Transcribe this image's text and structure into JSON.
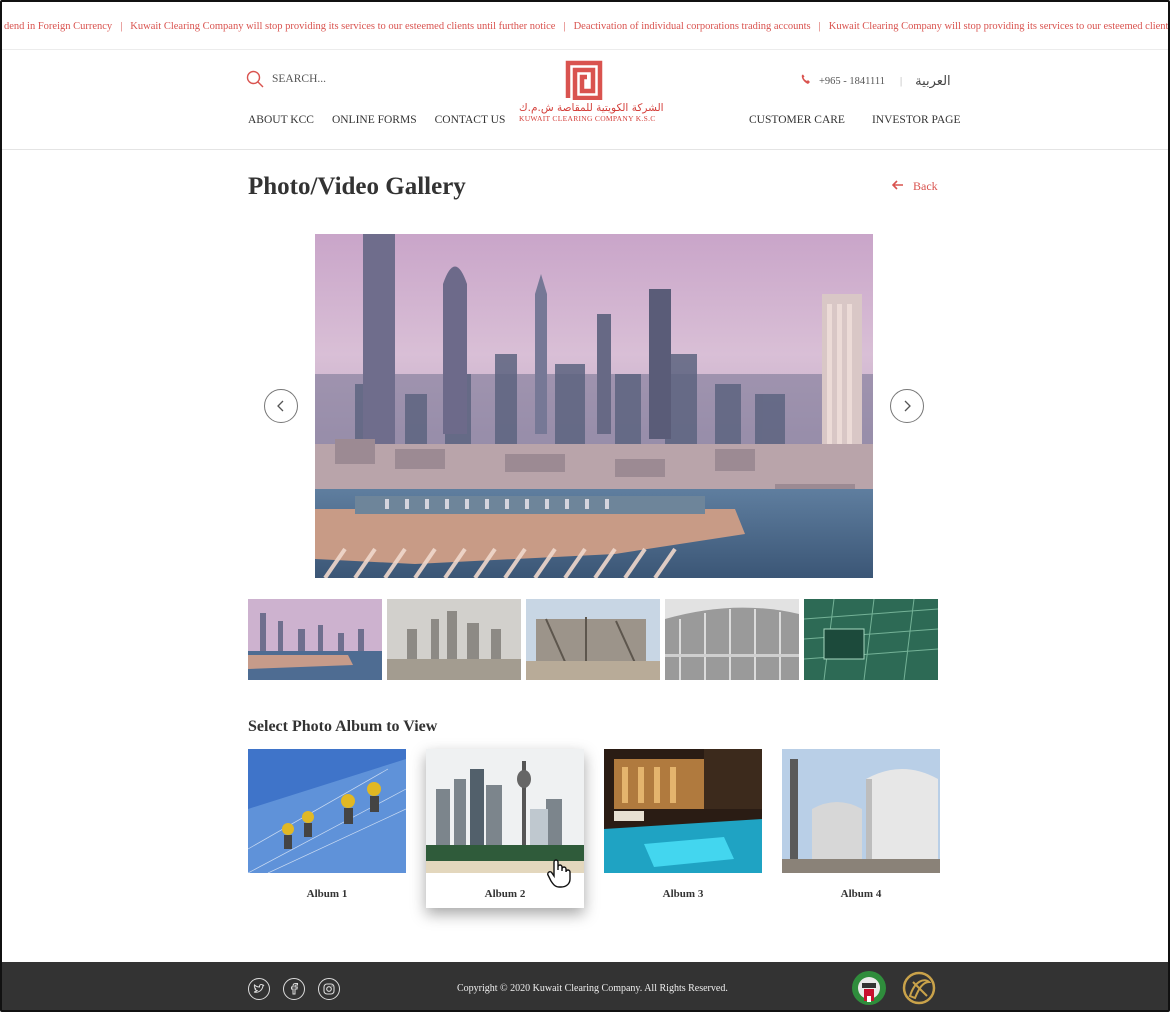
{
  "ticker": {
    "items": [
      "dend in Foreign Currency",
      "Kuwait Clearing Company will stop providing its services to our esteemed clients until further notice",
      "Deactivation of individual corporations trading accounts",
      "Kuwait Clearing Company will stop providing its services to our esteemed clients until f"
    ]
  },
  "header": {
    "search_label": "SEARCH...",
    "nav_left": [
      "ABOUT KCC",
      "ONLINE FORMS",
      "CONTACT US"
    ],
    "nav_right": [
      "CUSTOMER CARE",
      "INVESTOR PAGE"
    ],
    "logo_arabic": "الشركة الكويتية للمقاصة ش.م.ك",
    "logo_english": "KUWAIT CLEARING COMPANY K.S.C",
    "phone": "+965 - 1841111",
    "language": "العربية",
    "accent_color": "#d9534f"
  },
  "main": {
    "title": "Photo/Video Gallery",
    "back_label": "Back",
    "albums_title": "Select Photo Album to View",
    "albums": [
      {
        "label": "Album 1"
      },
      {
        "label": "Album 2"
      },
      {
        "label": "Album 3"
      },
      {
        "label": "Album 4"
      }
    ]
  },
  "footer": {
    "copyright": "Copyright © 2020 Kuwait Clearing Company. All Rights Reserved.",
    "social_icons": [
      "twitter-icon",
      "facebook-icon",
      "instagram-icon"
    ],
    "background": "#333333"
  }
}
